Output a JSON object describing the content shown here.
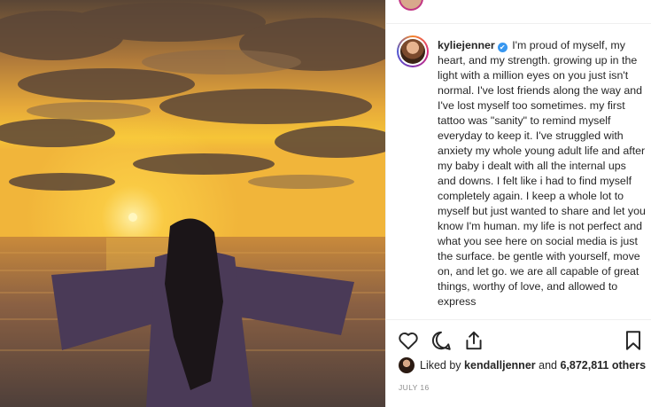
{
  "post": {
    "username": "kyliejenner",
    "verified_badge": "✔",
    "caption": "I'm proud of myself, my heart, and my strength. growing up in the light with a million eyes on you just isn't normal. I've lost friends along the way and I've lost myself too sometimes. my first tattoo was \"sanity\" to remind myself everyday to keep it. I've struggled with anxiety my whole young adult life and after my baby i dealt with all the internal ups and downs. I felt like i had to find myself completely again. I keep a whole lot to myself but just wanted to share and let you know I'm human. my life is not perfect and what you see here on social media is just the surface. be gentle with yourself, move on, and let go. we are all capable of great things, worthy of love, and allowed to express",
    "liked_by_prefix": "Liked by",
    "liked_by_user": "kendalljenner",
    "liked_by_and": "and",
    "likes_others": "6,872,811 others",
    "date": "JULY 16"
  },
  "icons": {
    "like": "heart-icon",
    "comment": "comment-bubble-icon",
    "share": "share-icon",
    "save": "bookmark-icon"
  },
  "colors": {
    "verified": "#3897f0",
    "text": "#262626",
    "muted": "#8e8e8e"
  }
}
